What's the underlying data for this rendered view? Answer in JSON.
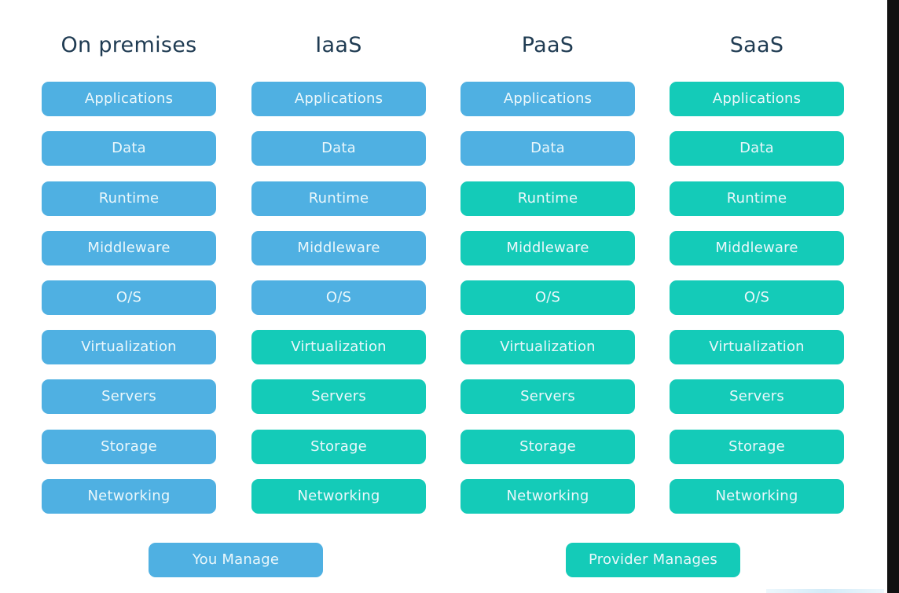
{
  "colors": {
    "you_manage": "#4fb0e2",
    "provider_manages": "#14cbb8",
    "header_text": "#1f3b52"
  },
  "columns": [
    {
      "title": "On premises",
      "provider_from_layer": 9
    },
    {
      "title": "IaaS",
      "provider_from_layer": 5
    },
    {
      "title": "PaaS",
      "provider_from_layer": 2
    },
    {
      "title": "SaaS",
      "provider_from_layer": 0
    }
  ],
  "layers": [
    "Applications",
    "Data",
    "Runtime",
    "Middleware",
    "O/S",
    "Virtualization",
    "Servers",
    "Storage",
    "Networking"
  ],
  "grid": [
    [
      "you",
      "you",
      "you",
      "provider"
    ],
    [
      "you",
      "you",
      "you",
      "provider"
    ],
    [
      "you",
      "you",
      "provider",
      "provider"
    ],
    [
      "you",
      "you",
      "provider",
      "provider"
    ],
    [
      "you",
      "you",
      "provider",
      "provider"
    ],
    [
      "you",
      "provider",
      "provider",
      "provider"
    ],
    [
      "you",
      "provider",
      "provider",
      "provider"
    ],
    [
      "you",
      "provider",
      "provider",
      "provider"
    ],
    [
      "you",
      "provider",
      "provider",
      "provider"
    ]
  ],
  "legend": {
    "you_manage": "You Manage",
    "provider_manages": "Provider Manages"
  }
}
